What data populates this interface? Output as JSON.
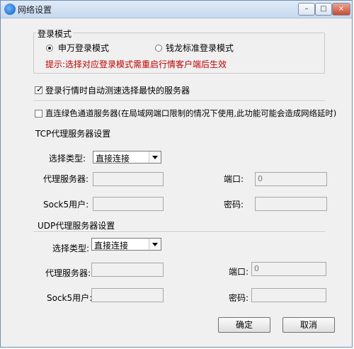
{
  "window": {
    "title": "网络设置",
    "buttons": {
      "minimize": "–",
      "maximize": "□",
      "close": "×"
    }
  },
  "login_mode": {
    "group_title": "登录模式",
    "options": [
      {
        "label": "申万登录模式",
        "selected": true
      },
      {
        "label": "钱龙标准登录模式",
        "selected": false
      }
    ],
    "hint": "提示:选择对应登录模式需重启行情客户端后生效"
  },
  "checkboxes": {
    "auto_fastest": {
      "label": "登录行情时自动测速选择最快的服务器",
      "checked": true
    },
    "green_channel": {
      "label": "直连绿色通道服务器(在局域网端口限制的情况下使用,此功能可能会造成网络延时)",
      "checked": false
    }
  },
  "tcp_proxy": {
    "section_title": "TCP代理服务器设置",
    "select_label": "选择类型:",
    "select_value": "直接连接",
    "proxy_label": "代理服务器:",
    "port_label": "端口:",
    "port_value": "0",
    "socks_user_label": "Sock5用户:",
    "password_label": "密码:"
  },
  "udp_proxy": {
    "section_title": "UDP代理服务器设置",
    "select_label": "选择类型:",
    "select_value": "直接连接",
    "proxy_label": "代理服务器:",
    "port_label": "端口:",
    "port_value": "0",
    "socks_user_label": "Sock5用户:",
    "password_label": "密码:"
  },
  "actions": {
    "ok": "确定",
    "cancel": "取消"
  }
}
